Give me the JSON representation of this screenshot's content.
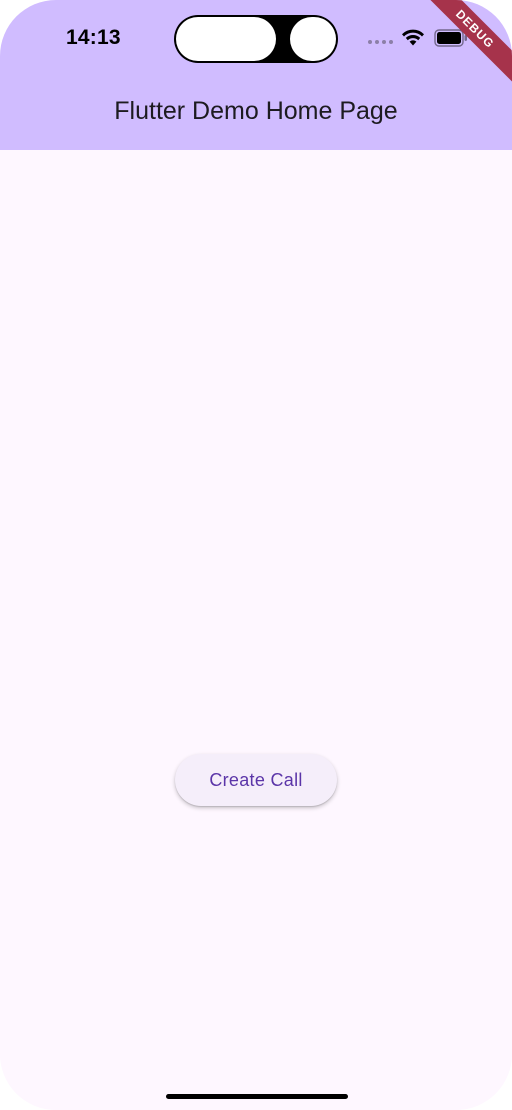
{
  "status_bar": {
    "time": "14:13"
  },
  "app_bar": {
    "title": "Flutter Demo Home Page"
  },
  "debug_banner": {
    "label": "DEBUG"
  },
  "main": {
    "create_call_label": "Create Call"
  },
  "colors": {
    "app_bar": "#d0bcff",
    "background": "#fef7ff",
    "button_bg": "#f5eefa",
    "button_text": "#5b35a8",
    "debug_ribbon": "#a6334b"
  },
  "icons": [
    "cellular-signal-icon",
    "wifi-icon",
    "battery-icon"
  ]
}
